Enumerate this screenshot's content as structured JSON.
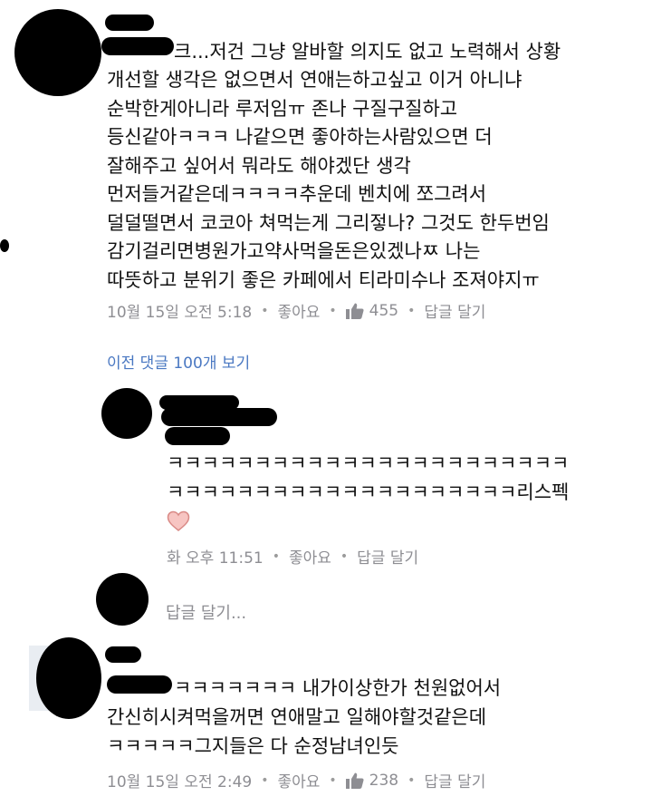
{
  "comments": [
    {
      "lines": [
        "크...저건 그냥 알바할 의지도 없고 노력해서 상황",
        "개선할 생각은 없으면서 연애는하고싶고 이거 아니냐",
        "순박한게아니라 루저임ㅠ 존나 구질구질하고",
        "등신같아ㅋㅋㅋ  나같으면 좋아하는사람있으면 더",
        "잘해주고 싶어서 뭐라도 해야겠단 생각",
        "먼저들거같은데ㅋㅋㅋㅋ추운데 벤치에 쪼그려서",
        "덜덜떨면서 코코아 쳐먹는게 그리젛나? 그것도 한두번임",
        "감기걸리면병원가고약사먹을돈은있겠나ㅉ 나는",
        "따뜻하고 분위기 좋은 카페에서 티라미수나 조져야지ㅠ"
      ],
      "time": "10월 15일 오전 5:18",
      "like_label": "좋아요",
      "like_count": "455",
      "reply_label": "답글 달기"
    },
    {
      "lines": [
        "ㅋㅋㅋㅋㅋㅋㅋㅋㅋㅋㅋㅋㅋㅋㅋㅋㅋㅋㅋㅋㅋㅋㅋ",
        "ㅋㅋㅋㅋㅋㅋㅋㅋㅋㅋㅋㅋㅋㅋㅋㅋㅋㅋㅋㅋ리스펙"
      ],
      "time": "화 오후 11:51",
      "like_label": "좋아요",
      "reply_label": "답글 달기"
    },
    {
      "lines": [
        "ㅋㅋㅋㅋㅋㅋㅋ 내가이상한가 천원없어서",
        "간신히시켜먹을꺼면 연애말고 일해야할것같은데",
        "ㅋㅋㅋㅋㅋ그지들은 다 순정남녀인듯"
      ],
      "time": "10월 15일 오전 2:49",
      "like_label": "좋아요",
      "like_count": "238",
      "reply_label": "답글 달기"
    }
  ],
  "previous_comments_link": "이전 댓글 100개 보기",
  "reply_input_placeholder": "답글 달기...",
  "icons": {
    "like": "thumbs-up-icon",
    "reaction": "heart-icon"
  },
  "colors": {
    "link": "#4a78c2",
    "meta": "#8e8e93",
    "heart_fill": "#f7c5c2",
    "heart_stroke": "#d98a86"
  }
}
